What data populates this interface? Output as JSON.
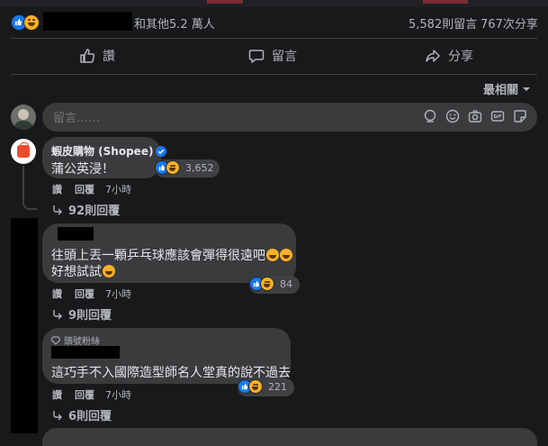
{
  "summary": {
    "others_text": "和其他5.2 萬人",
    "comments_count": "5,582則留言",
    "shares_count": "767次分享"
  },
  "actions": {
    "like_label": "讚",
    "comment_label": "留言",
    "share_label": "分享"
  },
  "sort": {
    "label": "最相關"
  },
  "composer": {
    "placeholder": "留言……"
  },
  "comments": [
    {
      "author": "蝦皮購物 (Shopee)",
      "text": "蒲公英浸！",
      "reaction_count": "3,652",
      "like_label": "讚",
      "reply_label": "回覆",
      "time": "7小時",
      "replies_label": "92則回覆"
    },
    {
      "line1": "往頭上丟一顆乒乓球應該會彈得很遠吧",
      "line2": "好想試試",
      "reaction_count": "84",
      "like_label": "讚",
      "reply_label": "回覆",
      "time": "7小時",
      "replies_label": "9則回覆"
    },
    {
      "badge": "頭號粉絲",
      "text": "這巧手不入國際造型師名人堂真的說不過去",
      "reaction_count": "221",
      "like_label": "讚",
      "reply_label": "回覆",
      "time": "7小時",
      "replies_label": "6則回覆"
    }
  ],
  "colors": {
    "background": "#18191a",
    "bubble": "#3a3b3c",
    "like_blue": "#1877f2",
    "haha_yellow": "#f7b125",
    "shopee_orange": "#ee4d2d"
  }
}
